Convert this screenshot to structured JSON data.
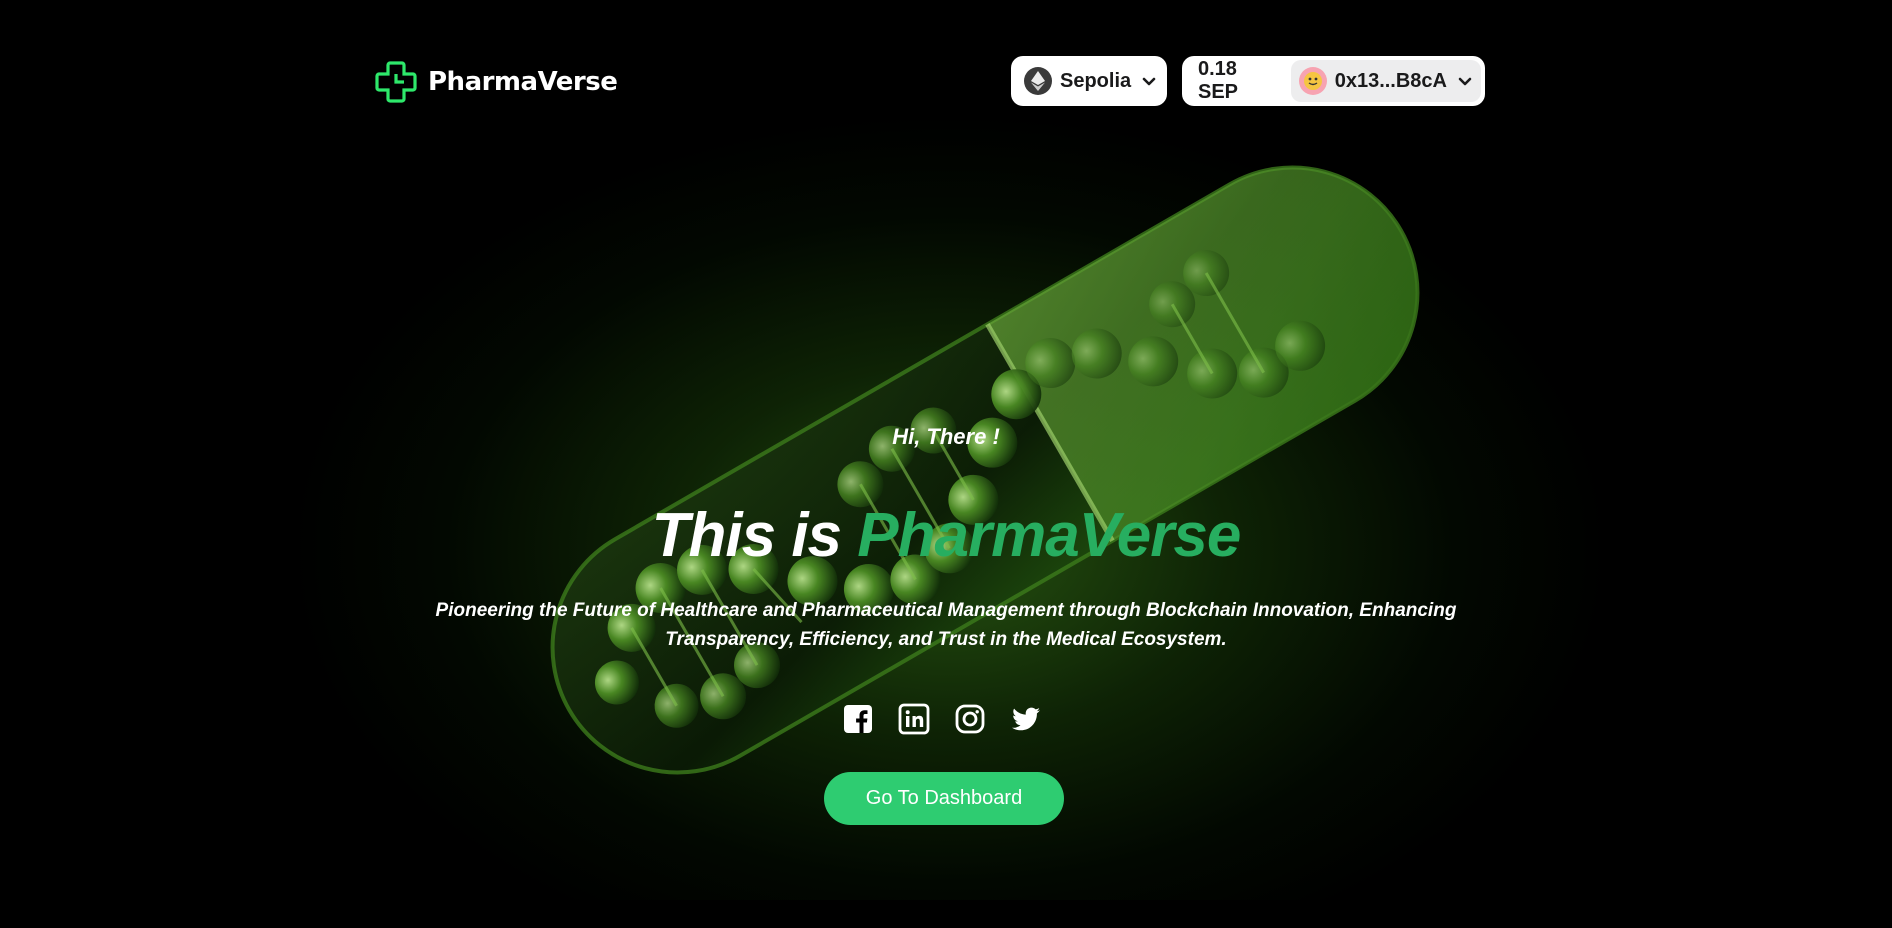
{
  "brand": {
    "name": "PharmaVerse",
    "accent_color": "#27ae60",
    "logo_icon": "medical-cross-icon"
  },
  "wallet": {
    "network_label": "Sepolia",
    "network_icon": "ethereum-icon",
    "balance": "0.18 SEP",
    "account": "0x13...B8cA",
    "avatar_icon": "emoji-avatar"
  },
  "hero": {
    "greeting": "Hi, There !",
    "headline_prefix": "This is ",
    "headline_accent": "PharmaVerse",
    "tagline": "Pioneering the Future of Healthcare and Pharmaceutical Management through Blockchain Innovation, Enhancing Transparency, Efficiency, and Trust in the Medical Ecosystem.",
    "cta_label": "Go To Dashboard",
    "cta_color": "#2ecc71"
  },
  "socials": [
    "facebook-icon",
    "linkedin-icon",
    "instagram-icon",
    "twitter-icon"
  ]
}
